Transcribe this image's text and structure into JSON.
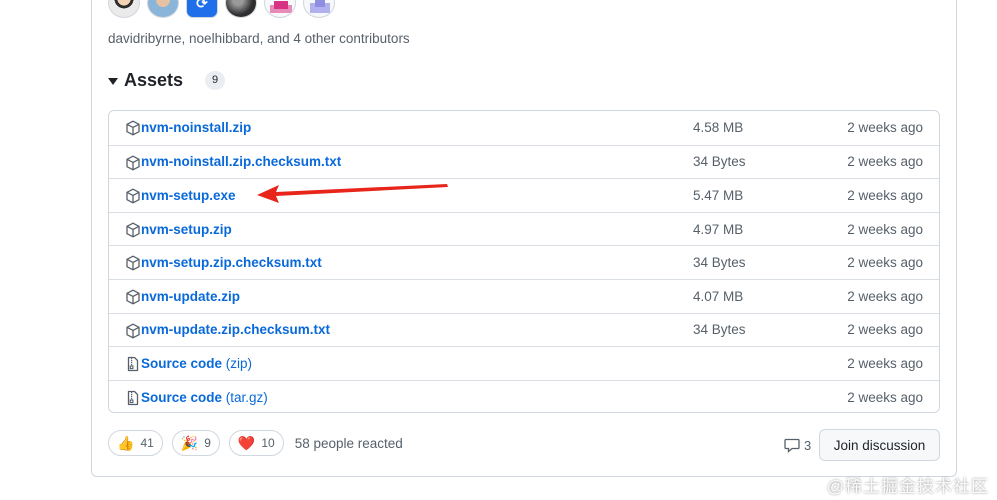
{
  "contributors": {
    "avatars": [
      "avatar-davidribyrne",
      "avatar-noelhibbard",
      "avatar-contributor-3",
      "avatar-contributor-4",
      "avatar-contributor-5",
      "avatar-contributor-6"
    ],
    "summary": "davidribyrne, noelhibbard, and 4 other contributors"
  },
  "assets": {
    "title": "Assets",
    "count": "9",
    "items": [
      {
        "name": "nvm-noinstall.zip",
        "suffix": "",
        "size": "4.58 MB",
        "date": "2 weeks ago",
        "icon": "package-icon"
      },
      {
        "name": "nvm-noinstall.zip.checksum.txt",
        "suffix": "",
        "size": "34 Bytes",
        "date": "2 weeks ago",
        "icon": "package-icon"
      },
      {
        "name": "nvm-setup.exe",
        "suffix": "",
        "size": "5.47 MB",
        "date": "2 weeks ago",
        "icon": "package-icon"
      },
      {
        "name": "nvm-setup.zip",
        "suffix": "",
        "size": "4.97 MB",
        "date": "2 weeks ago",
        "icon": "package-icon"
      },
      {
        "name": "nvm-setup.zip.checksum.txt",
        "suffix": "",
        "size": "34 Bytes",
        "date": "2 weeks ago",
        "icon": "package-icon"
      },
      {
        "name": "nvm-update.zip",
        "suffix": "",
        "size": "4.07 MB",
        "date": "2 weeks ago",
        "icon": "package-icon"
      },
      {
        "name": "nvm-update.zip.checksum.txt",
        "suffix": "",
        "size": "34 Bytes",
        "date": "2 weeks ago",
        "icon": "package-icon"
      },
      {
        "name": "Source code",
        "suffix": " (zip)",
        "size": "",
        "date": "2 weeks ago",
        "icon": "file-zip-icon"
      },
      {
        "name": "Source code",
        "suffix": " (tar.gz)",
        "size": "",
        "date": "2 weeks ago",
        "icon": "file-zip-icon"
      }
    ]
  },
  "reactions": {
    "items": [
      {
        "emoji": "👍",
        "icon": "thumbs-up-icon",
        "count": "41"
      },
      {
        "emoji": "🎉",
        "icon": "hooray-icon",
        "count": "9"
      },
      {
        "emoji": "❤️",
        "icon": "heart-icon",
        "count": "10"
      }
    ],
    "summary": "58 people reacted"
  },
  "discussion": {
    "comment_count": "3",
    "join_label": "Join discussion"
  },
  "watermark": "@稀土掘金技术社区",
  "colors": {
    "link": "#0969da",
    "muted": "#57606a",
    "border": "#d0d7de",
    "annotation_arrow": "#e8251b"
  }
}
